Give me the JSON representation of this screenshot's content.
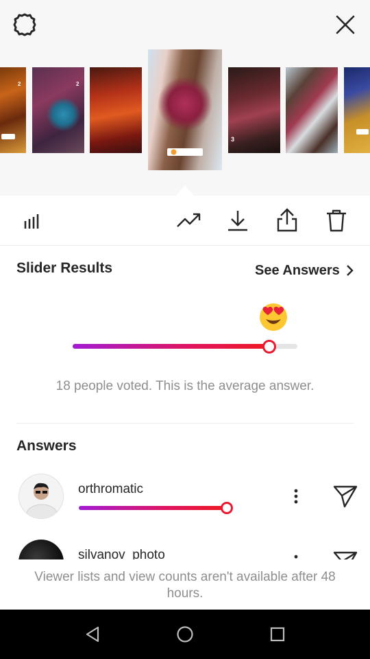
{
  "header": {
    "settings_icon": "settings-gear-icon",
    "close_icon": "close-icon"
  },
  "stories": [
    {
      "label": "2"
    },
    {
      "label": "2"
    },
    {
      "label": ""
    },
    {
      "label": ""
    },
    {
      "label": "3"
    },
    {
      "label": ""
    },
    {
      "label": ""
    }
  ],
  "toolbar": {
    "icons": [
      "insights-bars-icon",
      "trending-icon",
      "download-icon",
      "share-icon",
      "trash-icon"
    ]
  },
  "slider_results": {
    "title": "Slider Results",
    "see_answers_label": "See Answers",
    "emoji": "heart-eyes-emoji",
    "average_fraction": 0.875,
    "summary": "18 people voted. This is the average answer."
  },
  "answers": {
    "title": "Answers",
    "items": [
      {
        "username": "orthromatic",
        "value_fraction": 1.0
      },
      {
        "username": "silvanov_photo",
        "value_fraction": null
      }
    ]
  },
  "footer": {
    "note": "Viewer lists and view counts aren't available after 48 hours."
  },
  "colors": {
    "accent_start": "#a21bd3",
    "accent_end": "#ef1a22",
    "text_primary": "#262626",
    "text_secondary": "#8e8e8e"
  }
}
